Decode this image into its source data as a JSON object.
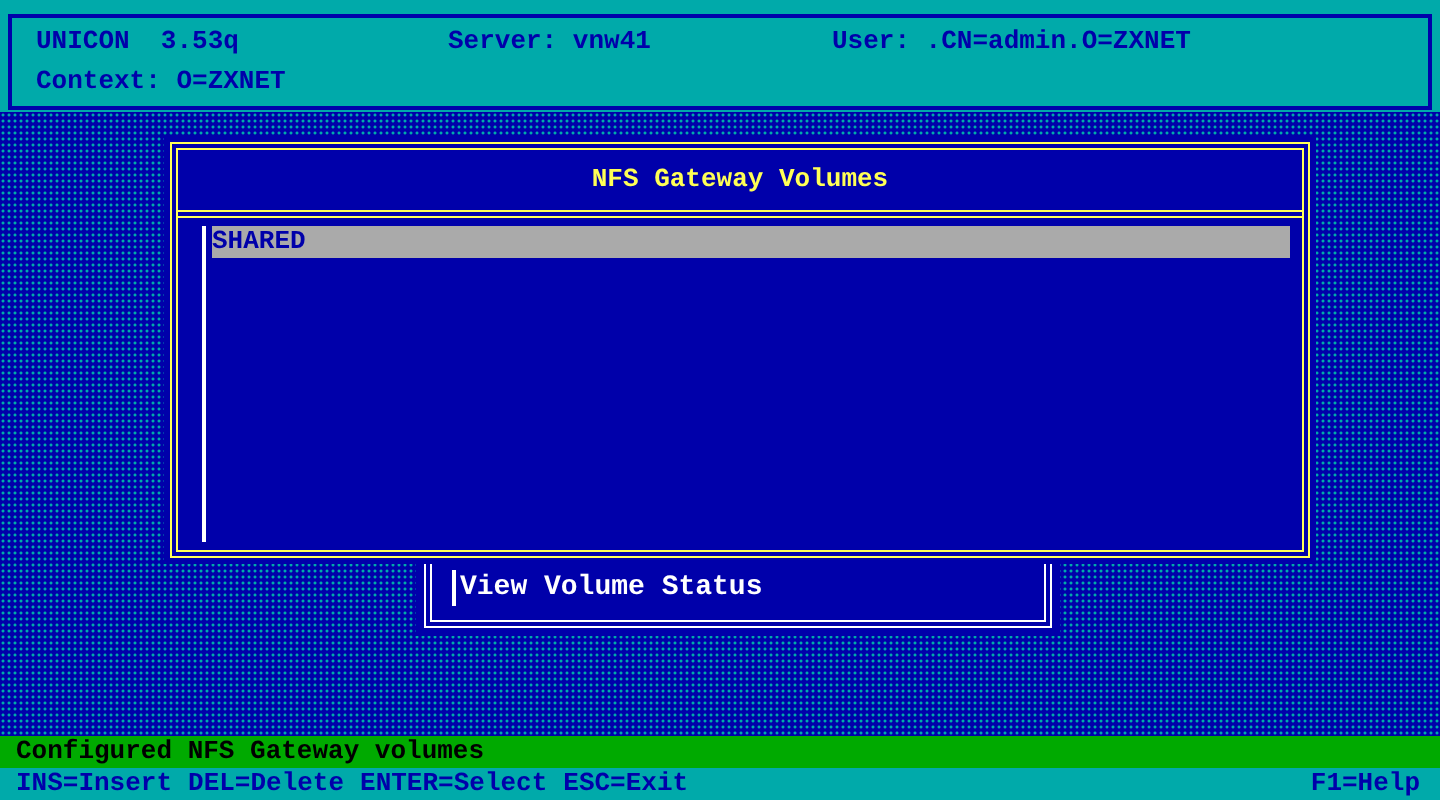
{
  "header": {
    "product": "UNICON  3.53q",
    "server": "Server: vnw41",
    "user": "User: .CN=admin.O=ZXNET",
    "context": "Context: O=ZXNET"
  },
  "dialog": {
    "title": "NFS Gateway Volumes",
    "items": [
      {
        "label": "SHARED",
        "selected": true
      }
    ]
  },
  "submenu": {
    "items": [
      {
        "label": "View Volume Status"
      }
    ]
  },
  "status_bar": {
    "message": "Configured NFS Gateway volumes",
    "keys": [
      "INS=Insert",
      "DEL=Delete",
      "ENTER=Select",
      "ESC=Exit"
    ],
    "help": "F1=Help"
  }
}
